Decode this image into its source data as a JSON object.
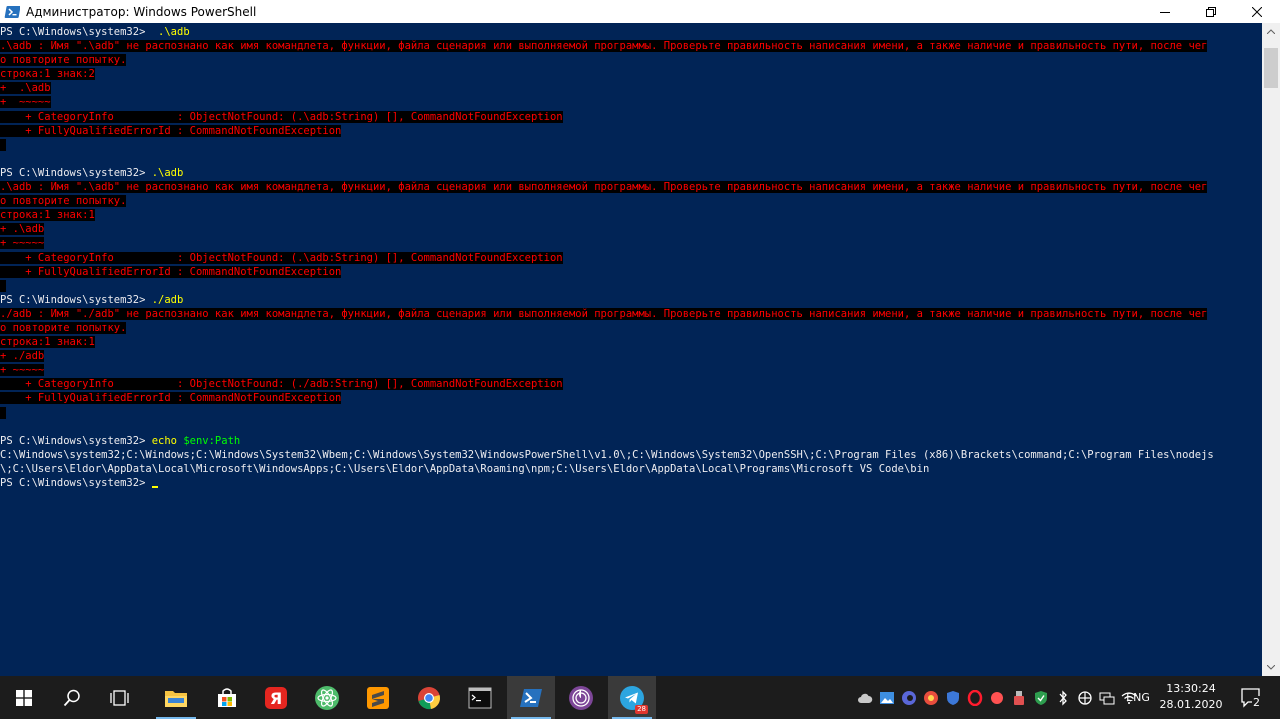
{
  "window": {
    "title": "Администратор: Windows PowerShell"
  },
  "console": {
    "lines": [
      {
        "parts": [
          {
            "t": "PS C:\\Windows\\system32> ",
            "c": "norm"
          },
          {
            "t": " .\\adb",
            "c": "cmd"
          }
        ]
      },
      {
        "parts": [
          {
            "t": ".\\adb : Имя \".\\adb\" не распознано как имя командлета, функции, файла сценария или выполняемой программы. Проверьте правильность написания имени, а также наличие и правильность пути, после чег",
            "c": "err"
          }
        ]
      },
      {
        "parts": [
          {
            "t": "о повторите попытку.",
            "c": "err"
          }
        ]
      },
      {
        "parts": [
          {
            "t": "строка:1 знак:2",
            "c": "err"
          }
        ]
      },
      {
        "parts": [
          {
            "t": "+  .\\adb",
            "c": "err"
          }
        ]
      },
      {
        "parts": [
          {
            "t": "+  ~~~~~",
            "c": "err"
          }
        ]
      },
      {
        "parts": [
          {
            "t": "    + CategoryInfo          : ObjectNotFound: (.\\adb:String) [], CommandNotFoundException",
            "c": "err"
          }
        ]
      },
      {
        "parts": [
          {
            "t": "    + FullyQualifiedErrorId : CommandNotFoundException",
            "c": "err"
          }
        ]
      },
      {
        "parts": [
          {
            "t": " ",
            "c": "err"
          }
        ]
      },
      {
        "parts": [
          {
            "t": "",
            "c": "norm"
          }
        ]
      },
      {
        "parts": [
          {
            "t": "PS C:\\Windows\\system32> ",
            "c": "norm"
          },
          {
            "t": ".\\adb",
            "c": "cmd"
          }
        ]
      },
      {
        "parts": [
          {
            "t": ".\\adb : Имя \".\\adb\" не распознано как имя командлета, функции, файла сценария или выполняемой программы. Проверьте правильность написания имени, а также наличие и правильность пути, после чег",
            "c": "err"
          }
        ]
      },
      {
        "parts": [
          {
            "t": "о повторите попытку.",
            "c": "err"
          }
        ]
      },
      {
        "parts": [
          {
            "t": "строка:1 знак:1",
            "c": "err"
          }
        ]
      },
      {
        "parts": [
          {
            "t": "+ .\\adb",
            "c": "err"
          }
        ]
      },
      {
        "parts": [
          {
            "t": "+ ~~~~~",
            "c": "err"
          }
        ]
      },
      {
        "parts": [
          {
            "t": "    + CategoryInfo          : ObjectNotFound: (.\\adb:String) [], CommandNotFoundException",
            "c": "err"
          }
        ]
      },
      {
        "parts": [
          {
            "t": "    + FullyQualifiedErrorId : CommandNotFoundException",
            "c": "err"
          }
        ]
      },
      {
        "parts": [
          {
            "t": " ",
            "c": "err"
          }
        ]
      },
      {
        "parts": [
          {
            "t": "PS C:\\Windows\\system32> ",
            "c": "norm"
          },
          {
            "t": "./adb",
            "c": "cmd"
          }
        ]
      },
      {
        "parts": [
          {
            "t": "./adb : Имя \"./adb\" не распознано как имя командлета, функции, файла сценария или выполняемой программы. Проверьте правильность написания имени, а также наличие и правильность пути, после чег",
            "c": "err"
          }
        ]
      },
      {
        "parts": [
          {
            "t": "о повторите попытку.",
            "c": "err"
          }
        ]
      },
      {
        "parts": [
          {
            "t": "строка:1 знак:1",
            "c": "err"
          }
        ]
      },
      {
        "parts": [
          {
            "t": "+ ./adb",
            "c": "err"
          }
        ]
      },
      {
        "parts": [
          {
            "t": "+ ~~~~~",
            "c": "err"
          }
        ]
      },
      {
        "parts": [
          {
            "t": "    + CategoryInfo          : ObjectNotFound: (./adb:String) [], CommandNotFoundException",
            "c": "err"
          }
        ]
      },
      {
        "parts": [
          {
            "t": "    + FullyQualifiedErrorId : CommandNotFoundException",
            "c": "err"
          }
        ]
      },
      {
        "parts": [
          {
            "t": " ",
            "c": "err"
          }
        ]
      },
      {
        "parts": [
          {
            "t": "",
            "c": "norm"
          }
        ]
      },
      {
        "parts": [
          {
            "t": "PS C:\\Windows\\system32> ",
            "c": "norm"
          },
          {
            "t": "echo ",
            "c": "cmd"
          },
          {
            "t": "$env:Path",
            "c": "var"
          }
        ]
      },
      {
        "parts": [
          {
            "t": "C:\\Windows\\system32;C:\\Windows;C:\\Windows\\System32\\Wbem;C:\\Windows\\System32\\WindowsPowerShell\\v1.0\\;C:\\Windows\\System32\\OpenSSH\\;C:\\Program Files (x86)\\Brackets\\command;C:\\Program Files\\nodejs",
            "c": "norm"
          }
        ]
      },
      {
        "parts": [
          {
            "t": "\\;C:\\Users\\Eldor\\AppData\\Local\\Microsoft\\WindowsApps;C:\\Users\\Eldor\\AppData\\Roaming\\npm;C:\\Users\\Eldor\\AppData\\Local\\Programs\\Microsoft VS Code\\bin",
            "c": "norm"
          }
        ]
      },
      {
        "parts": [
          {
            "t": "PS C:\\Windows\\system32> ",
            "c": "norm"
          }
        ],
        "cursor": true
      }
    ]
  },
  "taskbar": {
    "apps": [
      {
        "name": "start-button",
        "icon": "windows-logo-icon"
      },
      {
        "name": "search-button",
        "icon": "search-icon"
      },
      {
        "name": "task-view-button",
        "icon": "task-view-icon"
      },
      {
        "name": "file-explorer-button",
        "icon": "folder-icon"
      },
      {
        "name": "store-button",
        "icon": "store-icon"
      },
      {
        "name": "yandex-button",
        "icon": "yandex-browser-icon"
      },
      {
        "name": "atom-button",
        "icon": "atom-icon"
      },
      {
        "name": "sublime-text-button",
        "icon": "sublime-text-icon"
      },
      {
        "name": "chrome-button",
        "icon": "chrome-icon"
      },
      {
        "name": "terminal-button",
        "icon": "terminal-icon"
      },
      {
        "name": "powershell-button",
        "icon": "powershell-icon"
      },
      {
        "name": "tor-browser-button",
        "icon": "tor-icon"
      },
      {
        "name": "telegram-button",
        "icon": "telegram-icon",
        "badge": "28"
      }
    ],
    "language": "ENG",
    "time": "13:30:24",
    "date": "28.01.2020",
    "notifications_count": "2"
  },
  "colors": {
    "console_bg": "#012456",
    "error_fg": "#ff0000",
    "command_fg": "#ffff00",
    "variable_fg": "#00ff00",
    "taskbar_bg": "#1c1c1c"
  }
}
